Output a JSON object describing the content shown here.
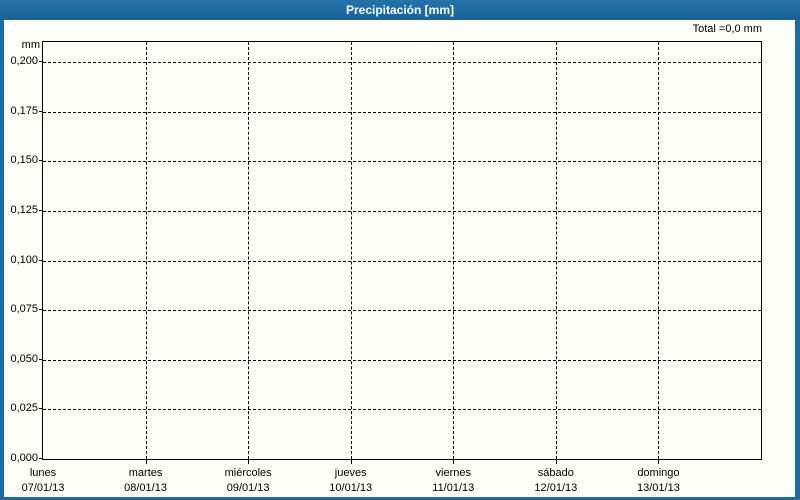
{
  "window": {
    "title": "Precipitación [mm]"
  },
  "chart_data": {
    "type": "bar",
    "title": "Precipitación [mm]",
    "total_label": "Total =0,0 mm",
    "total_value_mm": "0,0",
    "ylabel": "mm",
    "ylim": [
      0,
      0.2125
    ],
    "ytick_interval": 0.025,
    "yticks": [
      "0,200",
      "0,175",
      "0,150",
      "0,125",
      "0,100",
      "0,075",
      "0,050",
      "0,025",
      "0,000"
    ],
    "grid": "dashed",
    "legend": "none",
    "categories": [
      {
        "day": "lunes",
        "date": "07/01/13"
      },
      {
        "day": "martes",
        "date": "08/01/13"
      },
      {
        "day": "miércoles",
        "date": "09/01/13"
      },
      {
        "day": "jueves",
        "date": "10/01/13"
      },
      {
        "day": "viernes",
        "date": "11/01/13"
      },
      {
        "day": "sábado",
        "date": "12/01/13"
      },
      {
        "day": "domingo",
        "date": "13/01/13"
      }
    ],
    "series": [
      {
        "name": "Precipitación",
        "values": [
          0,
          0,
          0,
          0,
          0,
          0,
          0
        ]
      }
    ]
  },
  "colors": {
    "frame_blue": "#1e6ba3",
    "plot_background": "#fdfdfa",
    "grid_line": "#000000",
    "header_text": "#ffffff",
    "label_text": "#000000"
  }
}
